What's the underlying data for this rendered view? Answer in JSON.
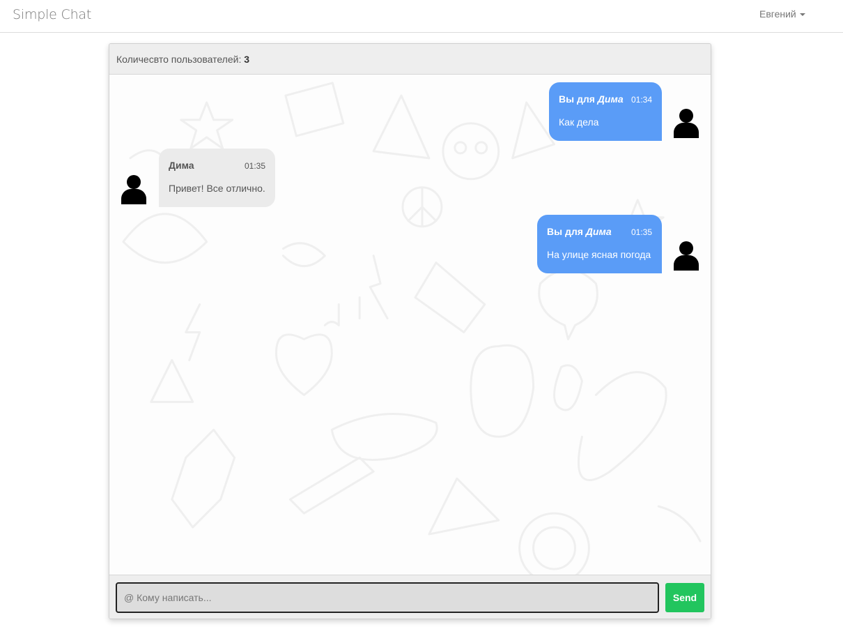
{
  "navbar": {
    "brand": "Simple Chat",
    "user": "Евгений"
  },
  "chat": {
    "users_label": "Количесвто пользователей:",
    "users_count": "3",
    "messages": [
      {
        "direction": "out",
        "prefix": "Вы для",
        "recipient": "Дима",
        "time": "01:34",
        "text": "Как дела"
      },
      {
        "direction": "in",
        "sender": "Дима",
        "time": "01:35",
        "text": "Привет! Все отлично."
      },
      {
        "direction": "out",
        "prefix": "Вы для",
        "recipient": "Дима",
        "time": "01:35",
        "text": "На улице ясная погода"
      }
    ]
  },
  "composer": {
    "placeholder": "@ Кому написать...",
    "value": "",
    "send_label": "Send"
  },
  "colors": {
    "outgoing_bubble": "#5a9cf7",
    "incoming_bubble": "#ebebeb",
    "send_button": "#22c55e"
  },
  "icons": {
    "avatar": "person-icon",
    "menu": "caret-down-icon"
  }
}
